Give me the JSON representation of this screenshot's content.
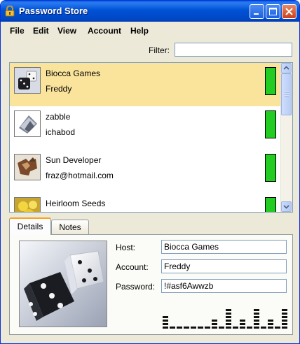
{
  "window": {
    "title": "Password Store",
    "icon": "padlock-icon"
  },
  "menu": [
    "File",
    "Edit",
    "View",
    "Account",
    "Help"
  ],
  "filter": {
    "label": "Filter:",
    "value": ""
  },
  "entries": [
    {
      "site": "Biocca Games",
      "user": "Freddy",
      "thumbnail": "dice-thumbnail",
      "selected": true,
      "strength_color": "#22cc22"
    },
    {
      "site": "zabble",
      "user": "ichabod",
      "thumbnail": "cards-thumbnail",
      "selected": false,
      "strength_color": "#22cc22"
    },
    {
      "site": "Sun Developer",
      "user": "fraz@hotmail.com",
      "thumbnail": "jigsaw-thumbnail",
      "selected": false,
      "strength_color": "#22cc22"
    },
    {
      "site": "Heirloom Seeds",
      "user": "",
      "thumbnail": "flower-thumbnail",
      "selected": false,
      "strength_color": "#22cc22"
    }
  ],
  "tabs": [
    "Details",
    "Notes"
  ],
  "active_tab": "Details",
  "details": {
    "host_label": "Host:",
    "host": "Biocca Games",
    "account_label": "Account:",
    "account": "Freddy",
    "password_label": "Password:",
    "password": "!#asf6Awwzb",
    "photo": "dice-photo"
  },
  "colors": {
    "selection": "#fae49c",
    "strength": "#22cc22",
    "titlebar": "#0052d6",
    "active_tab_accent": "#f9a21e"
  }
}
